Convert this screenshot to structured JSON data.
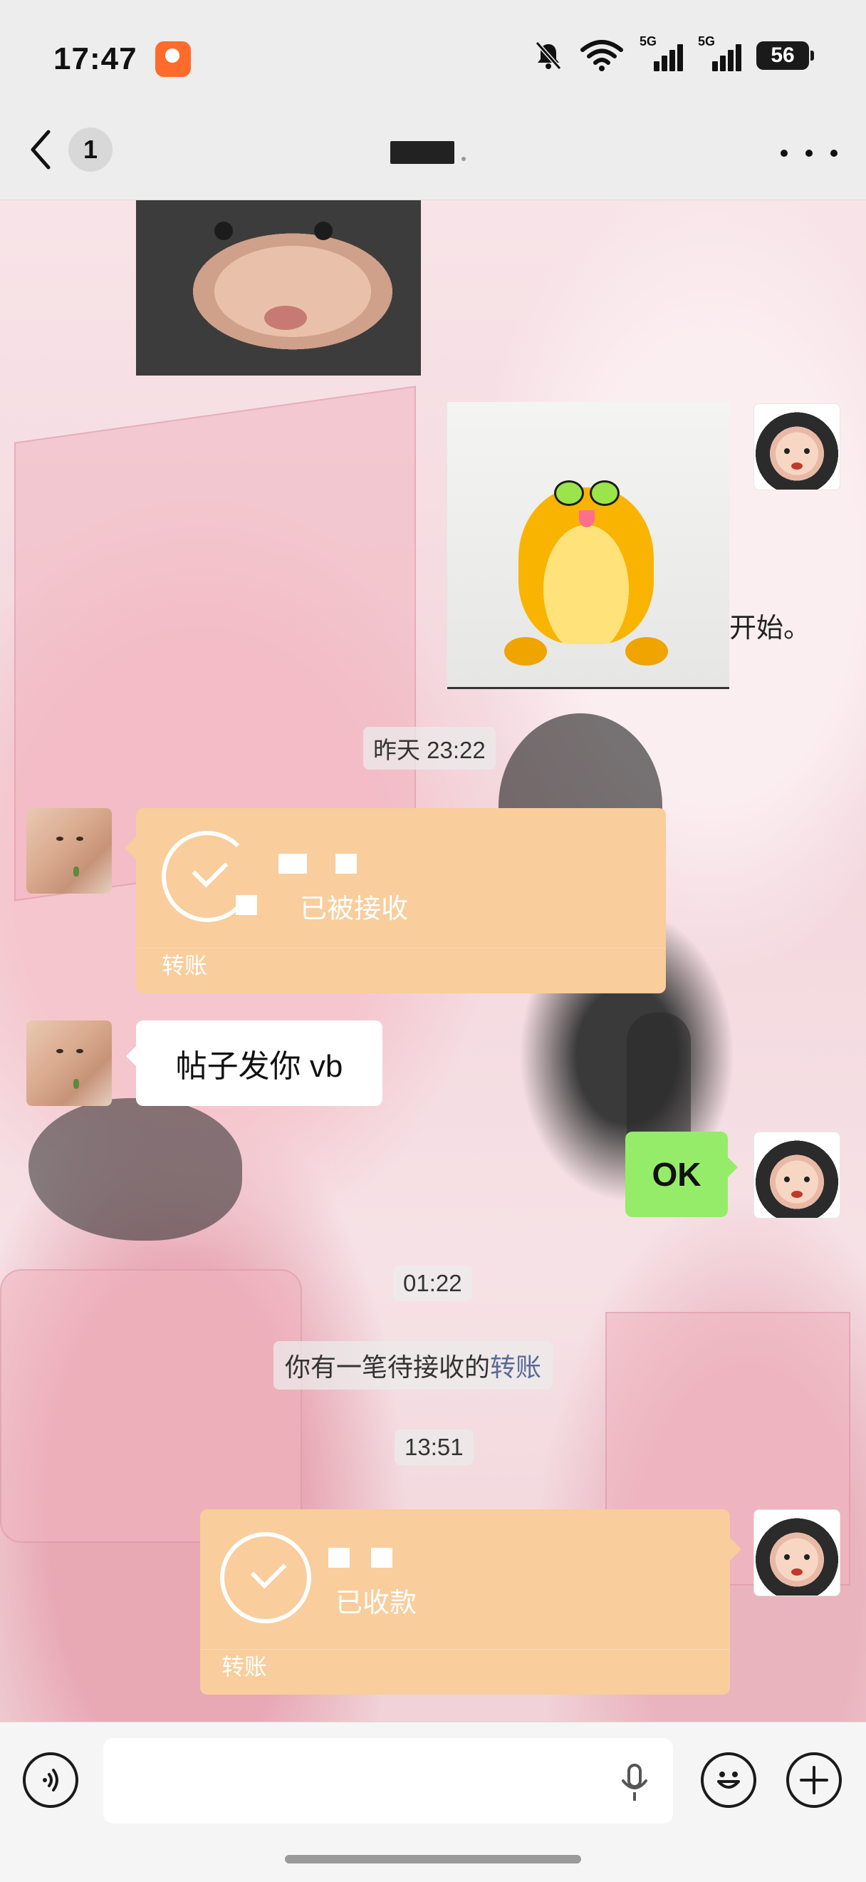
{
  "status_bar": {
    "time": "17:47",
    "signal_1_label": "5G",
    "signal_2_label": "5G",
    "battery": "56"
  },
  "nav": {
    "back_count": "1"
  },
  "messages": {
    "handwriting": "开始。",
    "time_1": "昨天 23:22",
    "transfer_1": {
      "status": "已被接收",
      "label": "转账"
    },
    "text_1": "帖子发你 vb",
    "text_2": "OK",
    "time_2": "01:22",
    "system": {
      "prefix": "你有一笔待接收的",
      "link": "转账"
    },
    "time_3": "13:51",
    "transfer_2": {
      "status": "已收款",
      "label": "转账"
    }
  },
  "colors": {
    "transfer": "#f9cd9c",
    "sent_bubble": "#95ec69",
    "link": "#576b95"
  },
  "icons": {
    "back": "chevron-left",
    "more": "ellipsis",
    "voice": "sound-wave",
    "mic": "microphone",
    "emoji": "smile",
    "plus": "plus"
  }
}
